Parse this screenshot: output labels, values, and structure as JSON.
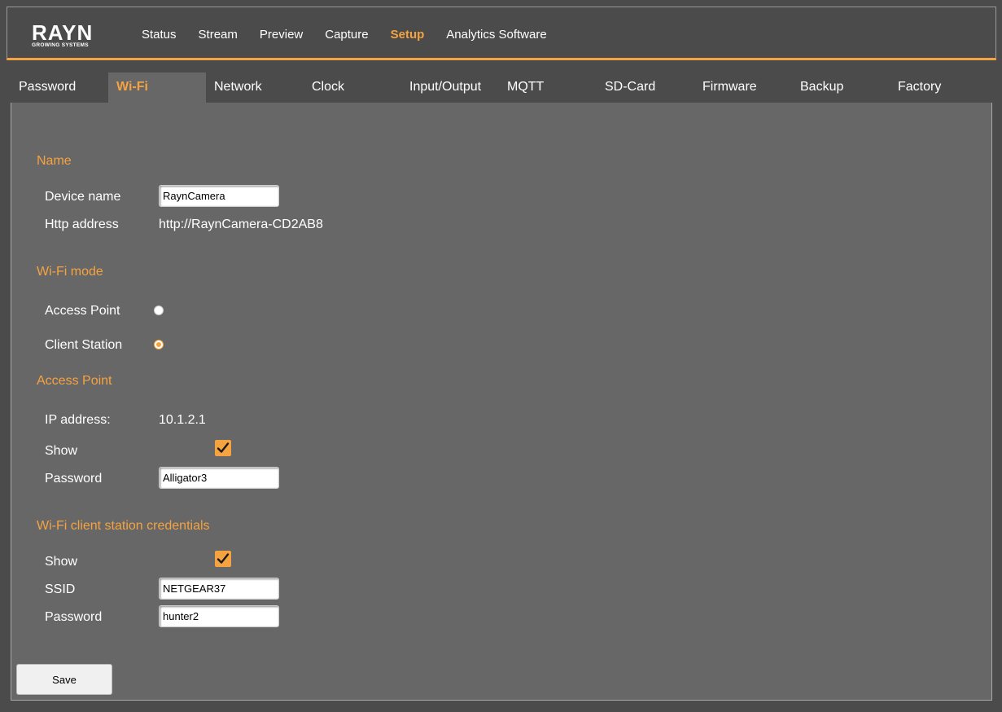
{
  "brand": {
    "logo_text": "RAYN",
    "logo_subtitle": "GROWING SYSTEMS"
  },
  "main_nav": [
    {
      "label": "Status",
      "active": false
    },
    {
      "label": "Stream",
      "active": false
    },
    {
      "label": "Preview",
      "active": false
    },
    {
      "label": "Capture",
      "active": false
    },
    {
      "label": "Setup",
      "active": true
    },
    {
      "label": "Analytics Software",
      "active": false
    }
  ],
  "sub_tabs": [
    {
      "label": "Password",
      "active": false
    },
    {
      "label": "Wi-Fi",
      "active": true
    },
    {
      "label": "Network",
      "active": false
    },
    {
      "label": "Clock",
      "active": false
    },
    {
      "label": "Input/Output",
      "active": false
    },
    {
      "label": "MQTT",
      "active": false
    },
    {
      "label": "SD-Card",
      "active": false
    },
    {
      "label": "Firmware",
      "active": false
    },
    {
      "label": "Backup",
      "active": false
    },
    {
      "label": "Factory",
      "active": false
    }
  ],
  "name_section": {
    "title": "Name",
    "device_name_label": "Device name",
    "device_name_value": "RaynCamera",
    "http_address_label": "Http address",
    "http_address_value": "http://RaynCamera-CD2AB8"
  },
  "wifi_mode": {
    "title": "Wi-Fi mode",
    "access_point_label": "Access Point",
    "access_point_selected": false,
    "client_station_label": "Client Station",
    "client_station_selected": true
  },
  "access_point": {
    "title": "Access Point",
    "ip_label": "IP address:",
    "ip_value": "10.1.2.1",
    "show_label": "Show",
    "show_checked": true,
    "password_label": "Password",
    "password_value": "Alligator3"
  },
  "client_credentials": {
    "title": "Wi-Fi client station credentials",
    "show_label": "Show",
    "show_checked": true,
    "ssid_label": "SSID",
    "ssid_value": "NETGEAR37",
    "password_label": "Password",
    "password_value": "hunter2"
  },
  "save_label": "Save",
  "colors": {
    "accent": "#f5a340",
    "background": "#4b4b4b",
    "panel": "#676767"
  }
}
